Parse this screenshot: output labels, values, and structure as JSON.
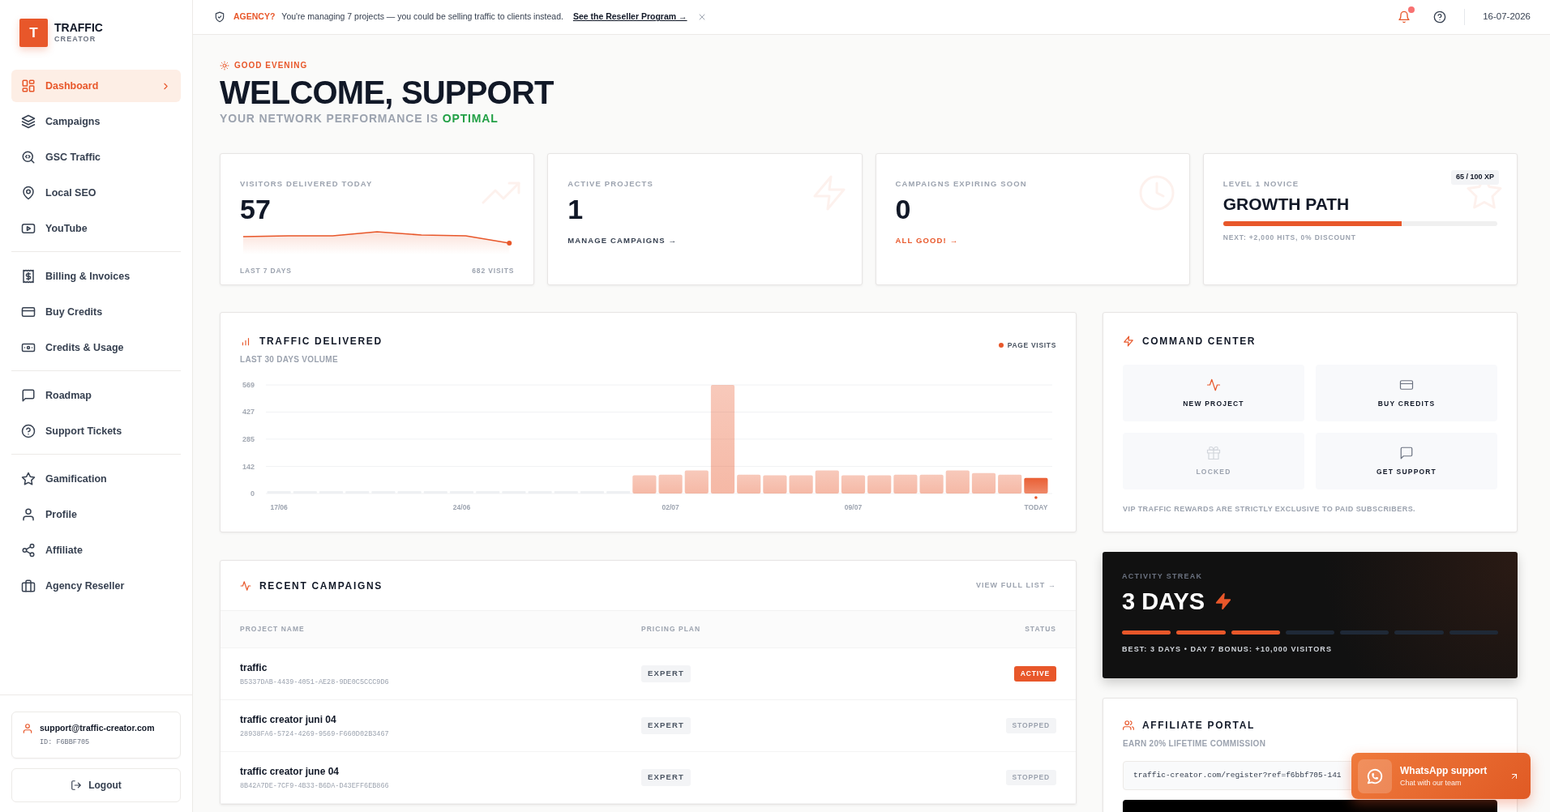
{
  "brand": {
    "logo_letter": "T",
    "name": "TRAFFIC",
    "tagline": "CREATOR"
  },
  "sidebar": {
    "groups": [
      [
        {
          "label": "Dashboard",
          "selected": true
        },
        {
          "label": "Campaigns",
          "selected": false
        },
        {
          "label": "GSC Traffic",
          "selected": false
        },
        {
          "label": "Local SEO",
          "selected": false
        },
        {
          "label": "YouTube",
          "selected": false
        }
      ],
      [
        {
          "label": "Billing & Invoices",
          "selected": false
        },
        {
          "label": "Buy Credits",
          "selected": false
        },
        {
          "label": "Credits & Usage",
          "selected": false
        }
      ],
      [
        {
          "label": "Roadmap",
          "selected": false
        },
        {
          "label": "Support Tickets",
          "selected": false
        }
      ],
      [
        {
          "label": "Gamification",
          "selected": false
        },
        {
          "label": "Profile",
          "selected": false
        },
        {
          "label": "Affiliate",
          "selected": false
        },
        {
          "label": "Agency Reseller",
          "selected": false
        }
      ]
    ]
  },
  "account": {
    "email": "support@traffic-creator.com",
    "id": "ID: F6BBF705"
  },
  "logout": "Logout",
  "banner": {
    "tag": "AGENCY?",
    "message": "You're managing 7 projects — you could be selling traffic to clients instead.",
    "link": "See the Reseller Program →"
  },
  "header": {
    "notifications_unread": true,
    "date": "16-07-2026"
  },
  "greeting": {
    "eyebrow": "GOOD EVENING",
    "title": "WELCOME, SUPPORT",
    "subtitle": "YOUR NETWORK PERFORMANCE IS",
    "status": "OPTIMAL"
  },
  "stats": [
    {
      "kind": "sparkline",
      "label": "VISITORS DELIVERED TODAY",
      "value": "57",
      "footer_left": "LAST 7 DAYS",
      "footer_right": "682 VISITS"
    },
    {
      "kind": "link",
      "label": "ACTIVE PROJECTS",
      "value": "1",
      "link": "MANAGE CAMPAIGNS →",
      "color": "#374151"
    },
    {
      "kind": "link",
      "label": "CAMPAIGNS EXPIRING SOON",
      "value": "0",
      "link": "ALL GOOD! →",
      "color": "#e8572a"
    },
    {
      "kind": "progress",
      "label": "LEVEL 1 NOVICE",
      "badge": "65 / 100 XP",
      "value": "GROWTH PATH",
      "level": 0.65,
      "note": "NEXT: +2,000 HITS, 0% DISCOUNT"
    }
  ],
  "traffic": {
    "title": "TRAFFIC DELIVERED",
    "subtitle": "LAST 30 DAYS VOLUME",
    "chart_data": {
      "type": "bar",
      "series": [
        {
          "name": "PAGE VISITS",
          "color": "#e8572a",
          "values": [
            0,
            0,
            0,
            0,
            0,
            0,
            0,
            0,
            0,
            0,
            0,
            0,
            0,
            0,
            96,
            99,
            121,
            569,
            99,
            96,
            96,
            121,
            96,
            96,
            99,
            99,
            121,
            107,
            99,
            82
          ]
        }
      ],
      "ylim": [
        0,
        569
      ],
      "yticks": [
        0,
        142,
        285,
        427,
        569
      ],
      "grid": true,
      "categories": [
        "17/06",
        null,
        null,
        null,
        null,
        null,
        null,
        "24/06",
        null,
        null,
        null,
        null,
        null,
        null,
        null,
        "02/07",
        null,
        null,
        null,
        null,
        null,
        null,
        "09/07",
        null,
        null,
        null,
        null,
        null,
        null,
        "TODAY"
      ]
    }
  },
  "command_center": {
    "title": "COMMAND CENTER",
    "actions": [
      {
        "label": "NEW PROJECT",
        "highlighted": true,
        "disabled": false
      },
      {
        "label": "BUY CREDITS",
        "highlighted": false,
        "disabled": false
      },
      {
        "label": "LOCKED",
        "highlighted": false,
        "disabled": true
      },
      {
        "label": "GET SUPPORT",
        "highlighted": false,
        "disabled": false
      }
    ],
    "note": "VIP TRAFFIC REWARDS ARE STRICTLY EXCLUSIVE TO PAID SUBSCRIBERS."
  },
  "campaigns": {
    "title": "RECENT CAMPAIGNS",
    "link": "VIEW FULL LIST →",
    "columns": [
      "PROJECT NAME",
      "PRICING PLAN",
      "STATUS"
    ],
    "rows": [
      {
        "name": "traffic",
        "id": "B5337DAB-4439-4051-AE28-9DE0C5CCC9D6",
        "plan": "EXPERT",
        "status": "ACTIVE",
        "active": true
      },
      {
        "name": "traffic creator juni 04",
        "id": "28938FA6-5724-4269-9569-F660D02B3467",
        "plan": "EXPERT",
        "status": "STOPPED",
        "active": false
      },
      {
        "name": "traffic creator june 04",
        "id": "8B42A7DE-7CF9-4B33-B6DA-D43EFF6EB866",
        "plan": "EXPERT",
        "status": "STOPPED",
        "active": false
      }
    ]
  },
  "streak": {
    "label": "ACTIVITY STREAK",
    "value": "3 DAYS",
    "segments": [
      {
        "filled": true
      },
      {
        "filled": true
      },
      {
        "filled": true
      },
      {
        "filled": false
      },
      {
        "filled": false
      },
      {
        "filled": false
      },
      {
        "filled": false
      }
    ],
    "note": "BEST: 3 DAYS • DAY 7 BONUS: +10,000 VISITORS"
  },
  "affiliate": {
    "title": "AFFILIATE PORTAL",
    "subtitle": "EARN 20% LIFETIME COMMISSION",
    "link_value": "traffic-creator.com/register?ref=f6bbf705-141"
  },
  "whatsapp": {
    "title": "WhatsApp support",
    "subtitle": "Chat with our team"
  }
}
